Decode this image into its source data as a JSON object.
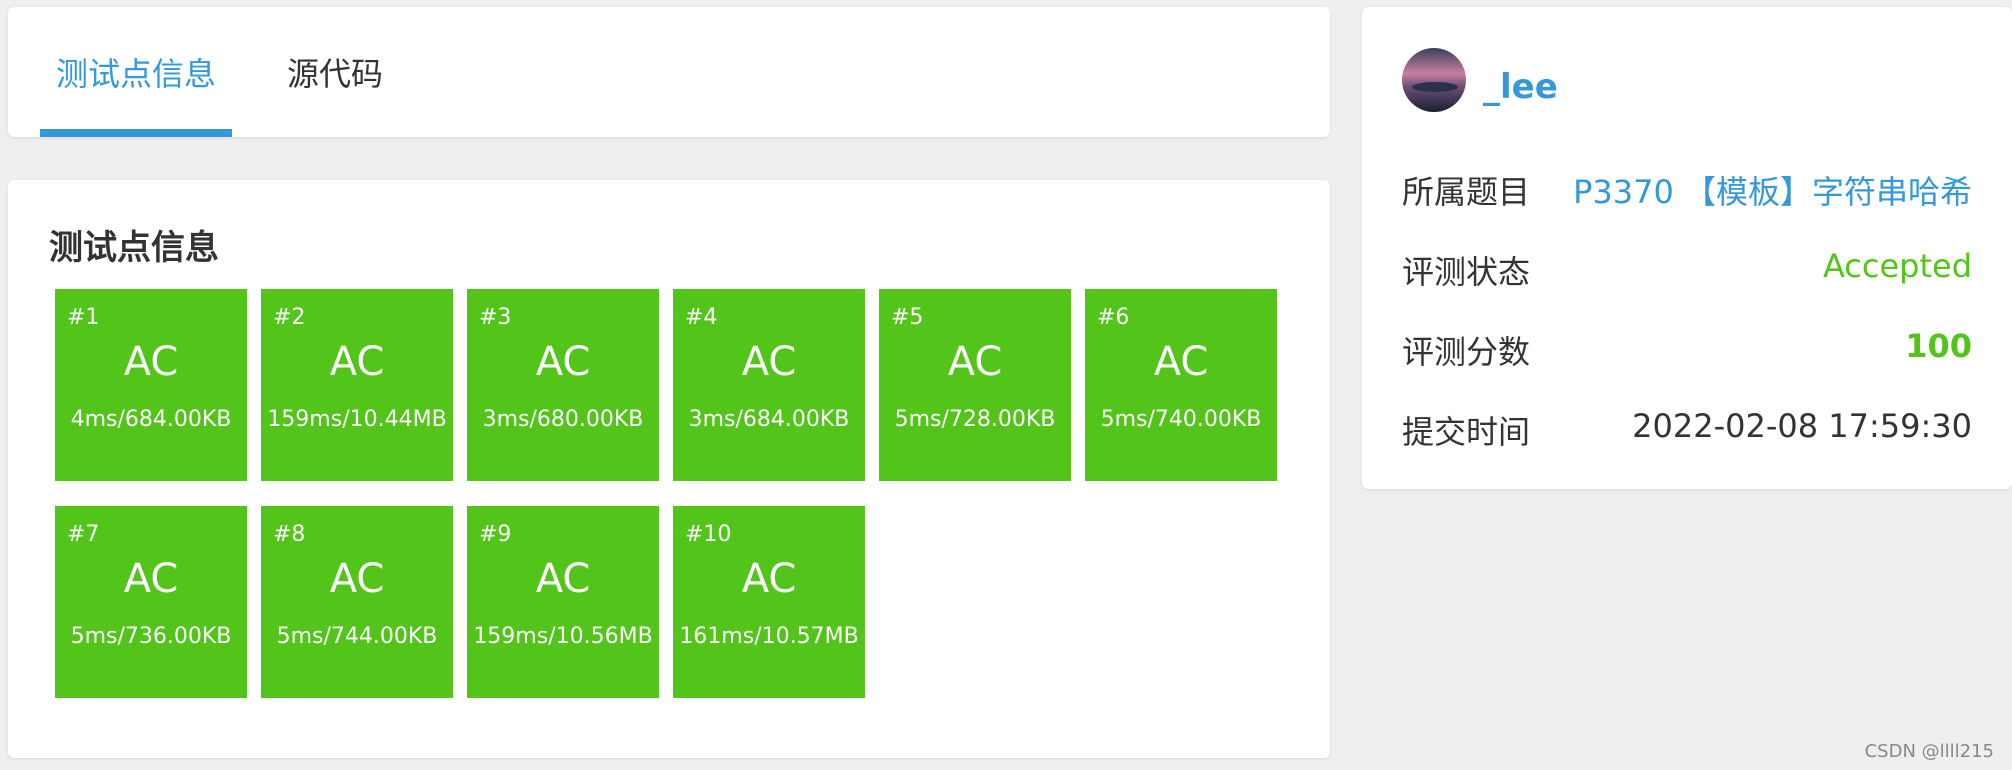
{
  "tabs": [
    {
      "label": "测试点信息",
      "active": true
    },
    {
      "label": "源代码",
      "active": false
    }
  ],
  "testcases": {
    "title": "测试点信息",
    "color": "#52c41a",
    "items": [
      {
        "num": "#1",
        "status": "AC",
        "info": "4ms/684.00KB"
      },
      {
        "num": "#2",
        "status": "AC",
        "info": "159ms/10.44MB"
      },
      {
        "num": "#3",
        "status": "AC",
        "info": "3ms/680.00KB"
      },
      {
        "num": "#4",
        "status": "AC",
        "info": "3ms/684.00KB"
      },
      {
        "num": "#5",
        "status": "AC",
        "info": "5ms/728.00KB"
      },
      {
        "num": "#6",
        "status": "AC",
        "info": "5ms/740.00KB"
      },
      {
        "num": "#7",
        "status": "AC",
        "info": "5ms/736.00KB"
      },
      {
        "num": "#8",
        "status": "AC",
        "info": "5ms/744.00KB"
      },
      {
        "num": "#9",
        "status": "AC",
        "info": "159ms/10.56MB"
      },
      {
        "num": "#10",
        "status": "AC",
        "info": "161ms/10.57MB"
      }
    ]
  },
  "record": {
    "username": "_lee",
    "problem_label": "所属题目",
    "problem_value": "P3370 【模板】字符串哈希",
    "status_label": "评测状态",
    "status_value": "Accepted",
    "score_label": "评测分数",
    "score_value": "100",
    "time_label": "提交时间",
    "time_value": "2022-02-08 17:59:30"
  },
  "watermark": "CSDN @llll215",
  "colors": {
    "accent": "#3498db",
    "success": "#52c41a"
  }
}
